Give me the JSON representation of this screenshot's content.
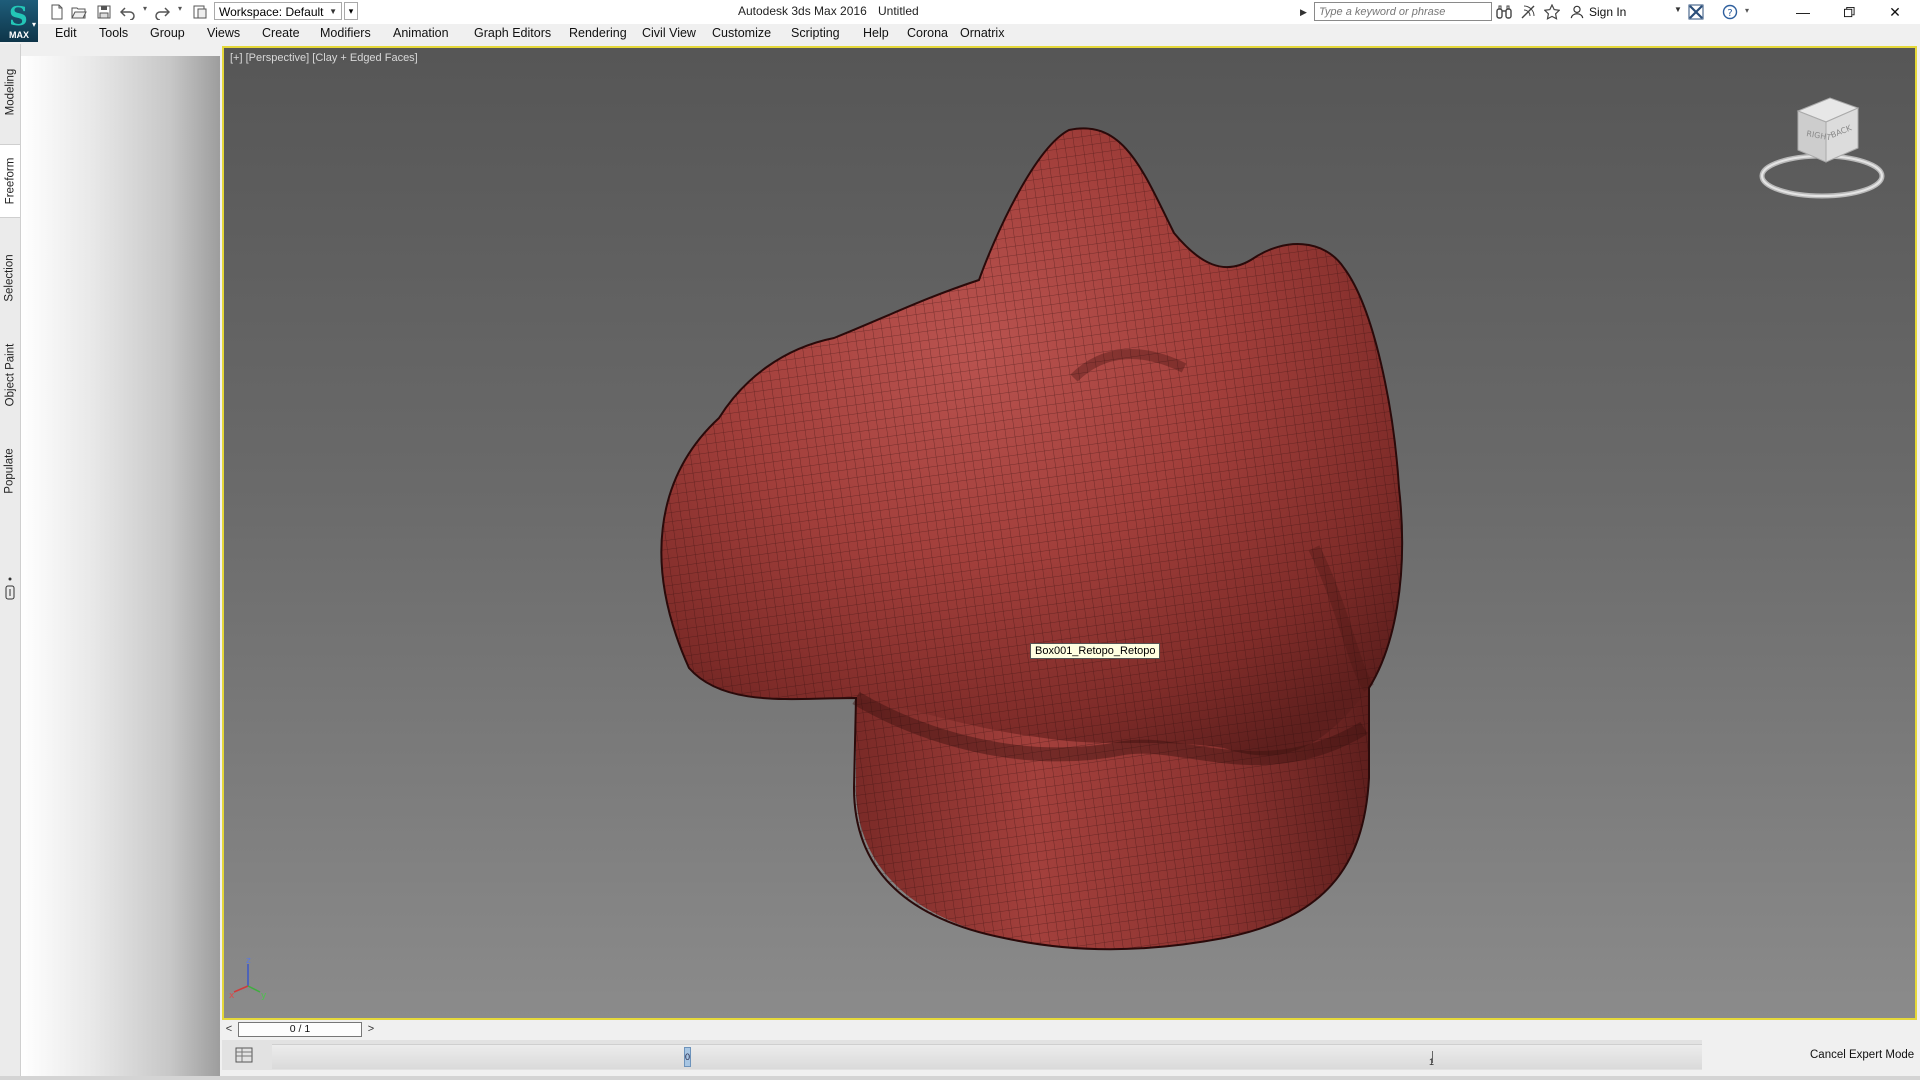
{
  "app": {
    "title": "Autodesk 3ds Max 2016",
    "document": "Untitled",
    "logo_text": "MAX"
  },
  "toolbar": {
    "workspace_label": "Workspace: Default",
    "search_placeholder": "Type a keyword or phrase",
    "signin_label": "Sign In"
  },
  "menu": [
    "Edit",
    "Tools",
    "Group",
    "Views",
    "Create",
    "Modifiers",
    "Animation",
    "Graph Editors",
    "Rendering",
    "Civil View",
    "Customize",
    "Scripting",
    "Help",
    "Corona",
    "Ornatrix"
  ],
  "side_tabs": [
    "Modeling",
    "Freeform",
    "Selection",
    "Object Paint",
    "Populate"
  ],
  "side_tabs_active": "Freeform",
  "viewport": {
    "label_plus": "[+]",
    "label_view": "[Perspective]",
    "label_shading": "[Clay + Edged Faces]",
    "object_tooltip": "Box001_Retopo_Retopo",
    "viewcube_labels": [
      "RIGHT",
      "BACK"
    ],
    "axis_labels": [
      "z",
      "x",
      "y"
    ],
    "mesh_color": "#9e3a37",
    "border_color": "#e5d83a"
  },
  "timeline": {
    "frame_display": "0 / 1",
    "prev_label": "<",
    "next_label": ">",
    "key_label": "0",
    "tick_1_label": "1"
  },
  "status": {
    "cancel_expert_label": "Cancel Expert Mode"
  },
  "icons": [
    "new-file-icon",
    "open-file-icon",
    "save-icon",
    "undo-icon",
    "redo-icon",
    "project-folder-icon",
    "binoculars-icon",
    "communication-center-icon",
    "favorites-star-icon",
    "user-icon",
    "autodesk-exchange-icon",
    "help-icon",
    "minimize-icon",
    "restore-icon",
    "close-icon"
  ]
}
